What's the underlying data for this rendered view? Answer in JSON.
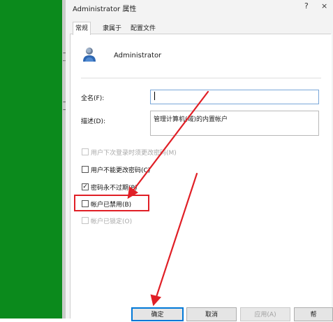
{
  "desktop": {
    "fragments": [
      "—",
      "--",
      "—",
      "—"
    ]
  },
  "window": {
    "title": "Administrator 属性",
    "help_glyph": "?",
    "close_glyph": "×"
  },
  "tabs": [
    {
      "label": "常规",
      "active": true
    },
    {
      "label": "隶属于",
      "active": false
    },
    {
      "label": "配置文件",
      "active": false
    }
  ],
  "user": {
    "name": "Administrator"
  },
  "form": {
    "full_name_label": "全名(F):",
    "full_name_value": "",
    "description_label": "描述(D):",
    "description_value": "管理计算机(域)的内置帐户"
  },
  "checkboxes": [
    {
      "label": "用户下次登录时须更改密码(M)",
      "checked": false,
      "enabled": false
    },
    {
      "label": "用户不能更改密码(C)",
      "checked": false,
      "enabled": true
    },
    {
      "label": "密码永不过期(P)",
      "checked": true,
      "enabled": true
    },
    {
      "label": "帐户已禁用(B)",
      "checked": false,
      "enabled": true
    },
    {
      "label": "帐户已锁定(O)",
      "checked": false,
      "enabled": false
    }
  ],
  "buttons": {
    "ok": "确定",
    "cancel": "取消",
    "apply": "应用(A)",
    "help": "帮"
  },
  "colors": {
    "desktop_green": "#0b8a1c",
    "annotation_red": "#e01f26",
    "focus_blue": "#0078d7"
  }
}
